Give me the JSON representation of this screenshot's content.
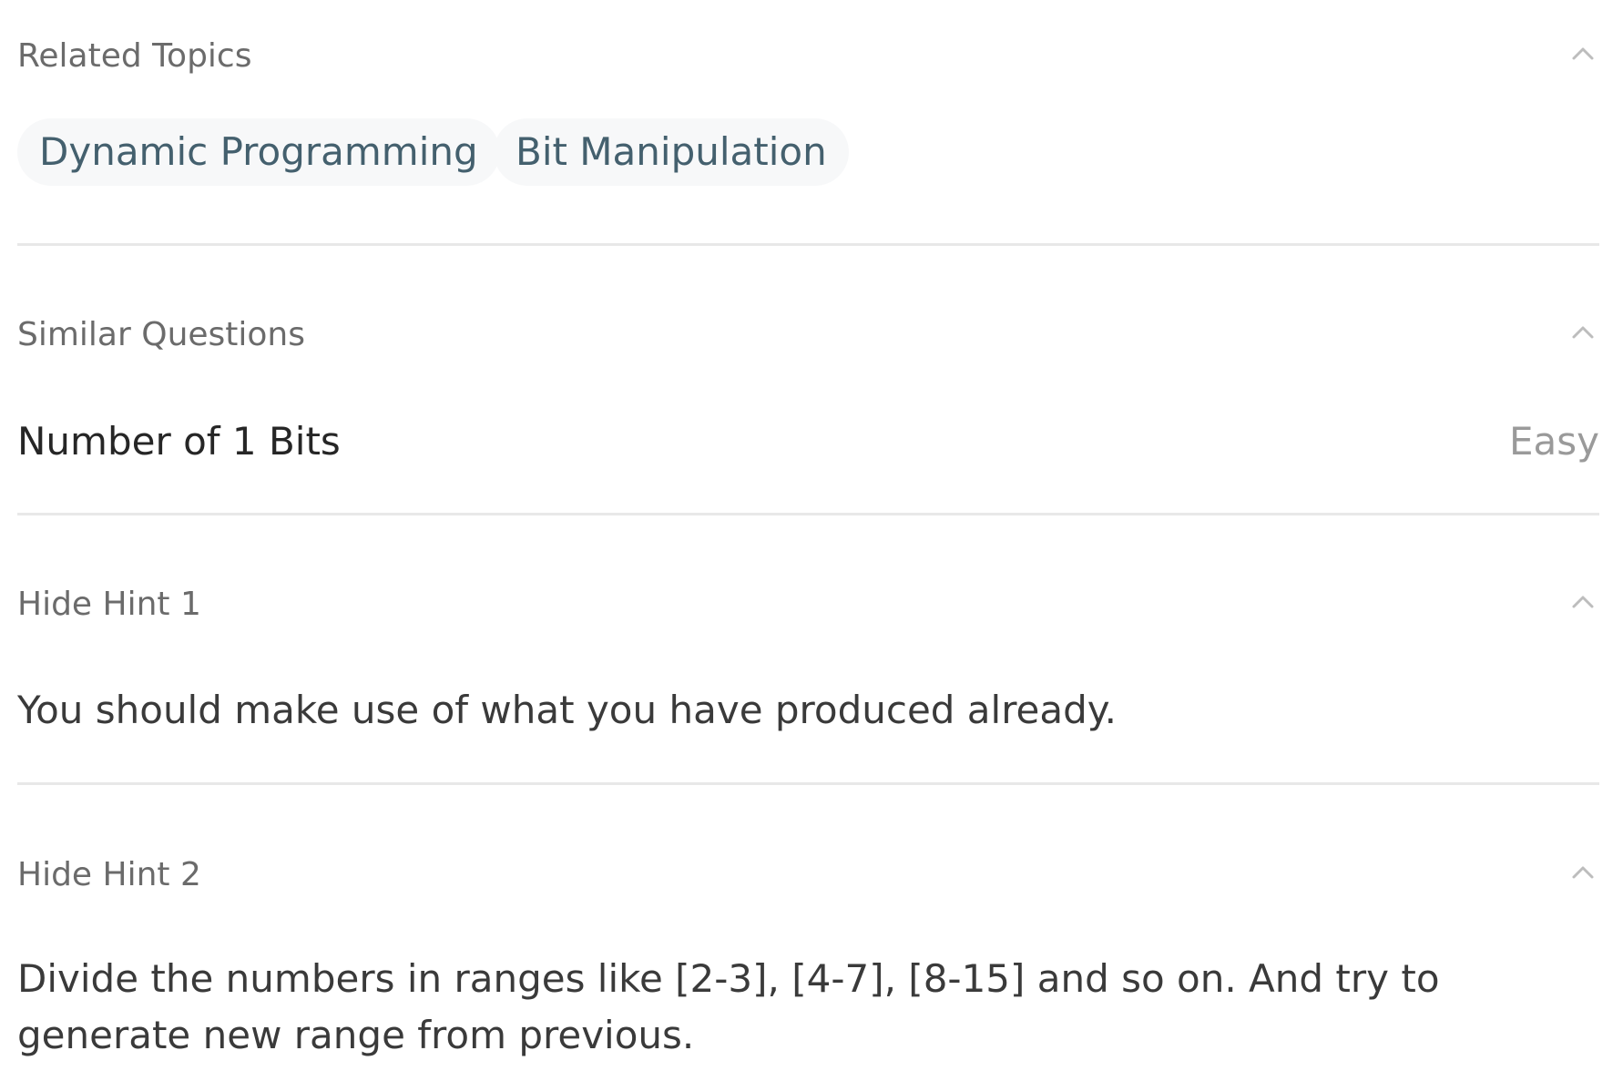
{
  "sections": {
    "related_topics": {
      "title": "Related Topics",
      "tags": [
        "Dynamic Programming",
        "Bit Manipulation"
      ]
    },
    "similar_questions": {
      "title": "Similar Questions",
      "items": [
        {
          "title": "Number of 1 Bits",
          "difficulty": "Easy"
        }
      ]
    },
    "hint_1": {
      "title": "Hide Hint 1",
      "text": "You should make use of what you have produced already."
    },
    "hint_2": {
      "title": "Hide Hint 2",
      "text": "Divide the numbers in ranges like [2-3], [4-7], [8-15] and so on. And try to generate new range from previous."
    }
  },
  "icons": {
    "collapse": "chevron-up-icon"
  },
  "colors": {
    "header_text": "#6b6b6b",
    "tag_text": "#44606e",
    "tag_bg": "#f7f8f9",
    "body_text": "#3a3a3a",
    "difficulty_text": "#9a9a9a",
    "divider": "#e8e8e8"
  }
}
